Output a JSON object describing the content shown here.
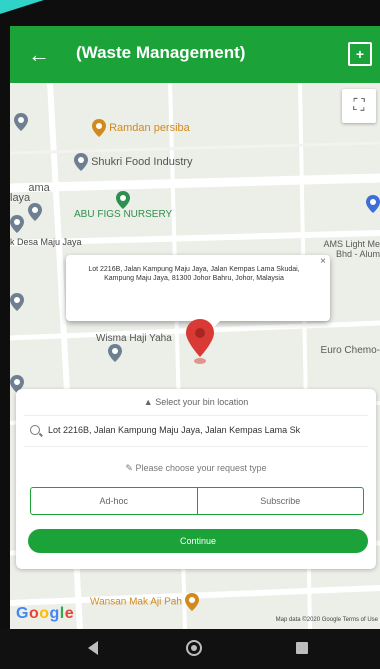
{
  "appbar": {
    "title": "(Waste Management)",
    "back_icon": "arrow-left-icon",
    "action_icon": "plus-box-icon"
  },
  "map": {
    "fullscreen_icon": "fullscreen-icon",
    "pois": [
      {
        "label": "Ramdan persiba",
        "color": "#d18a1e",
        "icon": "food-pin-icon"
      },
      {
        "label": "Shukri Food Industry",
        "color": "#6f7f92",
        "icon": "place-pin-icon"
      },
      {
        "label": "ABU FIGS NURSERY",
        "color": "#2f8f4e",
        "icon": "nursery-pin-icon"
      },
      {
        "label": "ama\nlaya",
        "color": "#6f7f92",
        "icon": "place-pin-icon"
      },
      {
        "label": "k Desa Maju Jaya",
        "color": "#444444",
        "icon": "none"
      },
      {
        "label": "AMS Light Me\nBhd - Alum",
        "color": "#5a5a5a",
        "icon": "place-pin-icon"
      },
      {
        "label": "Wisma Haji Yaha",
        "color": "#6f7f92",
        "icon": "place-pin-icon"
      },
      {
        "label": "Euro Chemo-",
        "color": "#5a5a5a",
        "icon": "none"
      },
      {
        "label": "Wansan Mak Aji Pah",
        "color": "#d18a1e",
        "icon": "food-pin-icon"
      }
    ],
    "info_window": {
      "address": "Lot 2216B, Jalan Kampung Maju Jaya, Jalan Kempas Lama Skudai, Kampung Maju Jaya, 81300 Johor Bahru, Johor, Malaysia",
      "close_icon": "close-icon"
    },
    "marker_icon": "location-marker-icon",
    "google_logo": "Google",
    "footer": "Map data ©2020 Google   Terms of Use"
  },
  "sheet": {
    "hint": "Select your bin location",
    "hint_icon": "location-arrow-icon",
    "search_icon": "search-icon",
    "search_value": "Lot 2216B, Jalan Kampung Maju Jaya, Jalan Kempas Lama Sk",
    "type_hint": "Please choose your request type",
    "type_hint_icon": "pencil-icon",
    "options": [
      "Ad-hoc",
      "Subscribe"
    ],
    "continue_label": "Continue"
  },
  "navbar": {
    "back_icon": "nav-back-icon",
    "home_icon": "nav-home-icon",
    "recent_icon": "nav-recent-icon"
  },
  "colors": {
    "primary": "#1ba33a",
    "marker": "#d93a35",
    "map_bg": "#eceee8"
  }
}
